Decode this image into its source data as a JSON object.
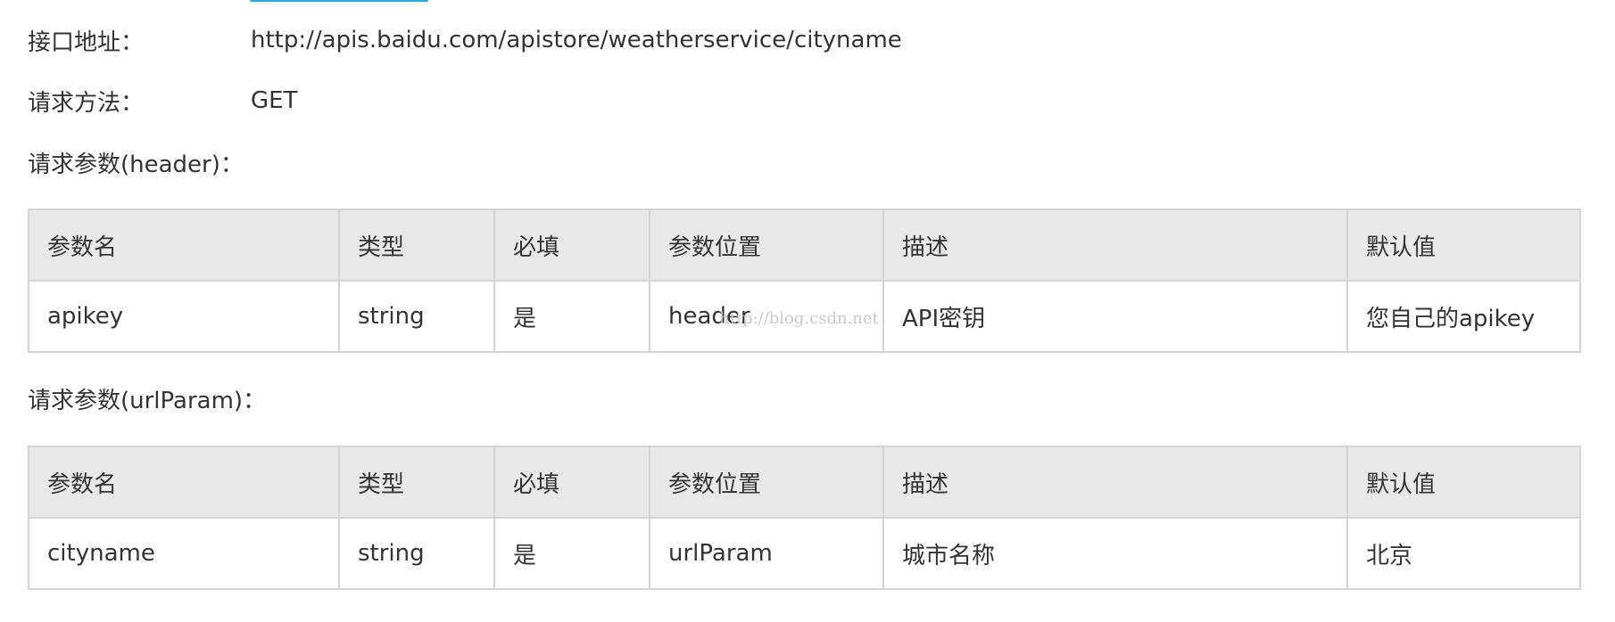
{
  "info": {
    "endpoint_label": "接口地址：",
    "endpoint_value": "http://apis.baidu.com/apistore/weatherservice/cityname",
    "method_label": "请求方法：",
    "method_value": "GET"
  },
  "sections": {
    "header_title": "请求参数(header)：",
    "urlparam_title": "请求参数(urlParam)："
  },
  "table_headers": [
    "参数名",
    "类型",
    "必填",
    "参数位置",
    "描述",
    "默认值"
  ],
  "header_params": [
    [
      "apikey",
      "string",
      "是",
      "header",
      "API密钥",
      "您自己的apikey"
    ]
  ],
  "url_params": [
    [
      "cityname",
      "string",
      "是",
      "urlParam",
      "城市名称",
      "北京"
    ]
  ],
  "watermark": "http://blog.csdn.net",
  "colors": {
    "text": "#333333",
    "header_bg": "#e8e8e8",
    "border": "#d5d5d5",
    "accent": "#2ea7e0"
  }
}
